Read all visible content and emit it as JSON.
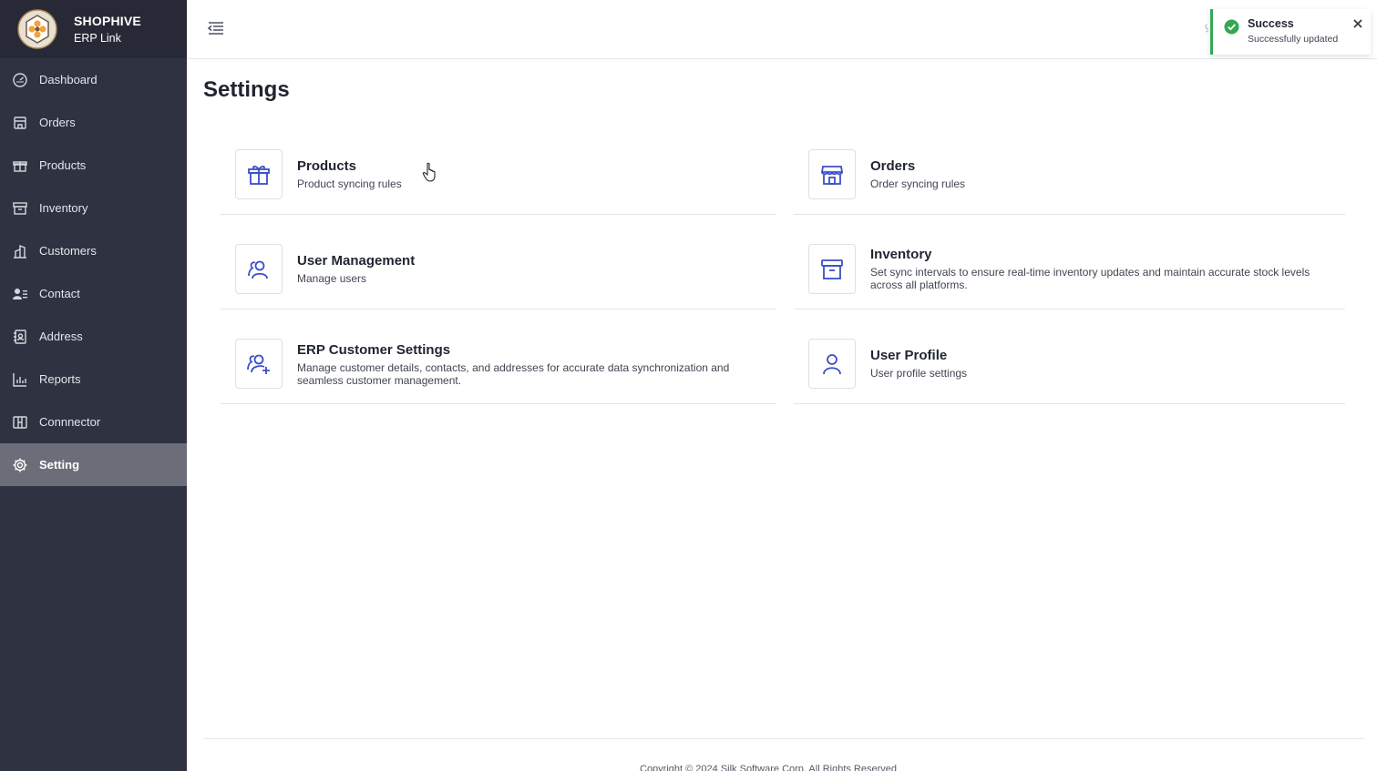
{
  "brand": {
    "name": "SHOPHIVE",
    "subtitle": "ERP Link"
  },
  "sidebar": {
    "items": [
      {
        "label": "Dashboard",
        "icon": "dashboard-icon"
      },
      {
        "label": "Orders",
        "icon": "orders-icon"
      },
      {
        "label": "Products",
        "icon": "gift-icon"
      },
      {
        "label": "Inventory",
        "icon": "archive-icon"
      },
      {
        "label": "Customers",
        "icon": "building-icon"
      },
      {
        "label": "Contact",
        "icon": "contact-icon"
      },
      {
        "label": "Address",
        "icon": "address-book-icon"
      },
      {
        "label": "Reports",
        "icon": "bar-chart-icon"
      },
      {
        "label": "Connnector",
        "icon": "connector-icon"
      },
      {
        "label": "Setting",
        "icon": "gear-icon",
        "active": true
      }
    ]
  },
  "toast": {
    "title": "Success",
    "message": "Successfully updated",
    "accent": "#34a853"
  },
  "main": {
    "title": "Settings",
    "cards": [
      {
        "title": "Products",
        "description": "Product syncing rules",
        "icon": "gift-icon"
      },
      {
        "title": "Orders",
        "description": "Order syncing rules",
        "icon": "store-icon"
      },
      {
        "title": "User Management",
        "description": "Manage users",
        "icon": "users-icon"
      },
      {
        "title": "Inventory",
        "description": "Set sync intervals to ensure real-time inventory updates and maintain accurate stock levels across all platforms.",
        "icon": "archive-icon"
      },
      {
        "title": "ERP Customer Settings",
        "description": "Manage customer details, contacts, and addresses for accurate data synchronization and seamless customer management.",
        "icon": "user-add-icon"
      },
      {
        "title": "User Profile",
        "description": "User profile settings",
        "icon": "user-icon"
      }
    ]
  },
  "footer": {
    "text": "Copyright © 2024 Silk Software Corp. All Rights Reserved"
  },
  "colors": {
    "sidebar_bg": "#2f3240",
    "brand_bg": "#272a36",
    "active_item": "#6b6e79",
    "icon_blue": "#3b4ec8"
  }
}
